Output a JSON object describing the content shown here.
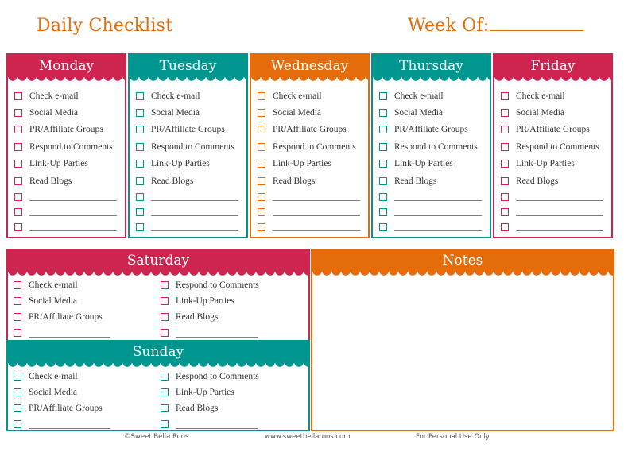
{
  "header": {
    "title": "Daily Checklist",
    "week_of_label": "Week Of:"
  },
  "colors": {
    "crimson": "#CE2550",
    "teal": "#009690",
    "orange": "#E46C0A"
  },
  "days": [
    {
      "name": "Monday",
      "color": "crimson",
      "items": [
        "Check e-mail",
        "Social Media",
        "PR/Affiliate Groups",
        "Respond to Comments",
        "Link-Up Parties",
        "Read Blogs"
      ],
      "blank_lines": 3
    },
    {
      "name": "Tuesday",
      "color": "teal",
      "items": [
        "Check e-mail",
        "Social Media",
        "PR/Affiliate Groups",
        "Respond to Comments",
        "Link-Up Parties",
        "Read Blogs"
      ],
      "blank_lines": 3
    },
    {
      "name": "Wednesday",
      "color": "orange",
      "items": [
        "Check e-mail",
        "Social Media",
        "PR/Affiliate Groups",
        "Respond to Comments",
        "Link-Up Parties",
        "Read Blogs"
      ],
      "blank_lines": 3
    },
    {
      "name": "Thursday",
      "color": "teal",
      "items": [
        "Check e-mail",
        "Social Media",
        "PR/Affiliate Groups",
        "Respond to Comments",
        "Link-Up Parties",
        "Read Blogs"
      ],
      "blank_lines": 3
    },
    {
      "name": "Friday",
      "color": "crimson",
      "items": [
        "Check e-mail",
        "Social Media",
        "PR/Affiliate Groups",
        "Respond to Comments",
        "Link-Up Parties",
        "Read Blogs"
      ],
      "blank_lines": 3
    }
  ],
  "weekend": [
    {
      "name": "Saturday",
      "color": "crimson",
      "left_items": [
        "Check e-mail",
        "Social Media",
        "PR/Affiliate Groups"
      ],
      "right_items": [
        "Respond to Comments",
        "Link-Up Parties",
        "Read Blogs"
      ]
    },
    {
      "name": "Sunday",
      "color": "teal",
      "left_items": [
        "Check e-mail",
        "Social Media",
        "PR/Affiliate Groups"
      ],
      "right_items": [
        "Respond to Comments",
        "Link-Up Parties",
        "Read Blogs"
      ]
    }
  ],
  "notes": {
    "title": "Notes",
    "color": "orange"
  },
  "footer": {
    "copyright": "©Sweet Bella Roos",
    "url": "www.sweetbellaroos.com",
    "usage": "For Personal Use Only"
  }
}
